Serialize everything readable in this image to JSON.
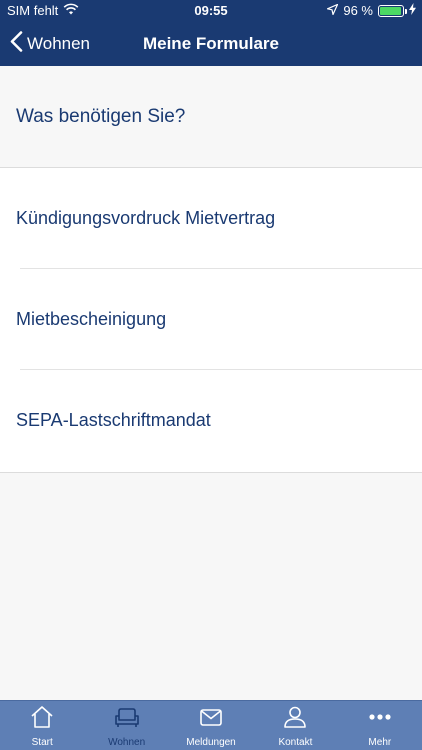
{
  "status": {
    "carrier": "SIM fehlt",
    "time": "09:55",
    "battery": "96 %",
    "battery_level": 0.96
  },
  "nav": {
    "back_label": "Wohnen",
    "title": "Meine Formulare"
  },
  "section": {
    "heading": "Was benötigen Sie?"
  },
  "forms": [
    {
      "label": "Kündigungsvordruck Mietvertrag"
    },
    {
      "label": "Mietbescheinigung"
    },
    {
      "label": "SEPA-Lastschriftmandat"
    }
  ],
  "tabs": [
    {
      "label": "Start",
      "icon": "home-icon"
    },
    {
      "label": "Wohnen",
      "icon": "sofa-icon",
      "active": true
    },
    {
      "label": "Meldungen",
      "icon": "mail-icon"
    },
    {
      "label": "Kontakt",
      "icon": "person-icon"
    },
    {
      "label": "Mehr",
      "icon": "more-icon"
    }
  ],
  "colors": {
    "primary": "#1a3a72",
    "tabbar": "#5e7fb5",
    "battery": "#4cd964"
  }
}
